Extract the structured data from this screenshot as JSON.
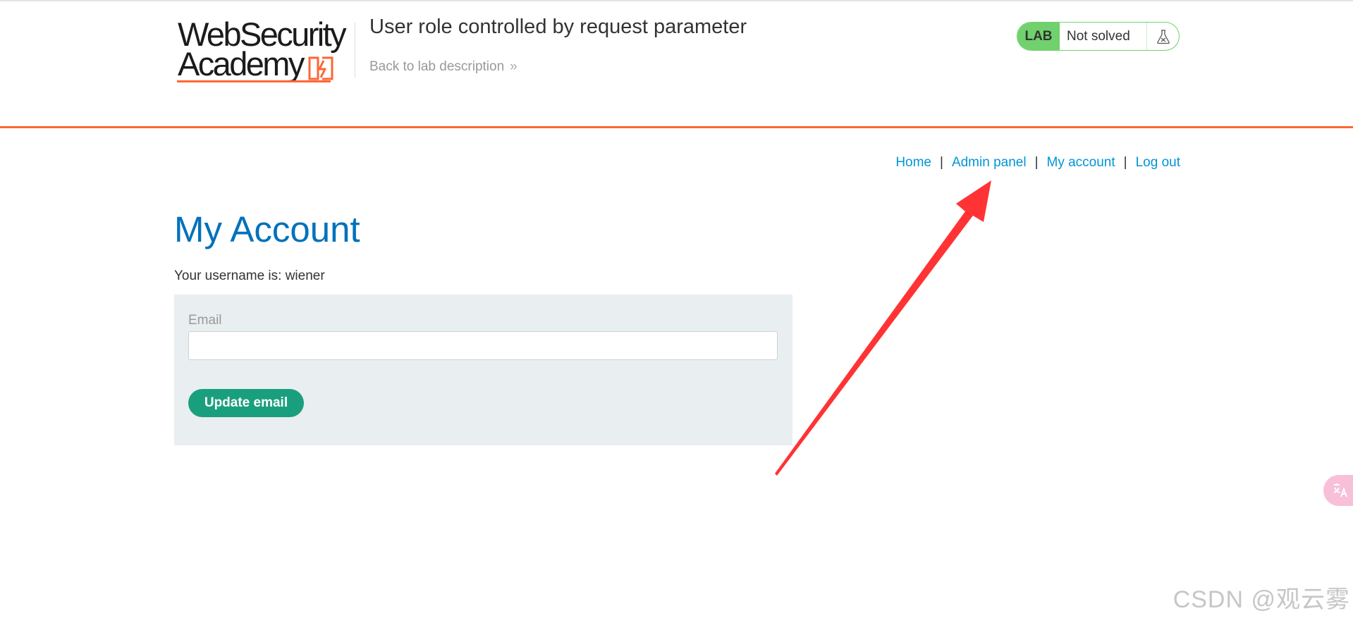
{
  "header": {
    "logo_line1": "WebSecurity",
    "logo_line2": "Academy",
    "lab_title": "User role controlled by request parameter",
    "back_link": "Back to lab description",
    "back_chevron": "»",
    "lab_badge": "LAB",
    "lab_status": "Not solved",
    "lab_icon": "flask-icon"
  },
  "nav": {
    "home": "Home",
    "admin_panel": "Admin panel",
    "my_account": "My account",
    "log_out": "Log out",
    "separator": "|"
  },
  "main": {
    "title": "My Account",
    "username_line": "Your username is: wiener",
    "email_label": "Email",
    "email_value": "",
    "update_button": "Update email"
  },
  "overlay": {
    "translate_icon": "translate-icon",
    "watermark": "CSDN @观云雾"
  },
  "colors": {
    "accent_orange": "#ff6633",
    "heading_blue": "#0071bc",
    "link_blue": "#0095d6",
    "lab_green": "#70d16d",
    "button_green": "#1a9f7e",
    "arrow_red": "#ff3333"
  }
}
